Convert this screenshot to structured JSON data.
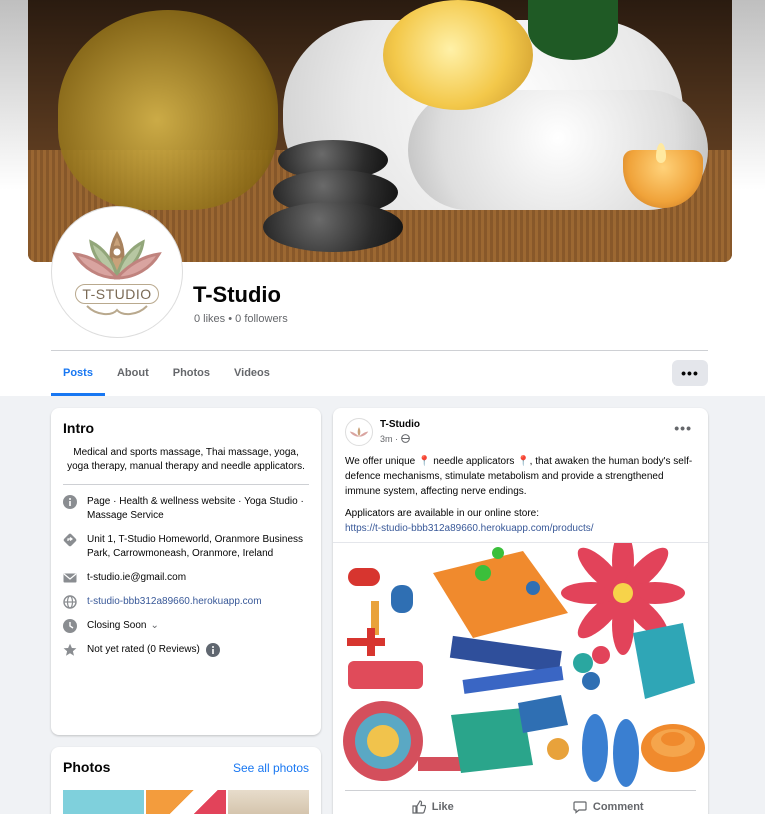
{
  "page": {
    "name": "T-Studio",
    "stats": "0 likes • 0 followers",
    "logo_text": "T-STUDIO"
  },
  "tabs": [
    {
      "label": "Posts",
      "active": true
    },
    {
      "label": "About",
      "active": false
    },
    {
      "label": "Photos",
      "active": false
    },
    {
      "label": "Videos",
      "active": false
    }
  ],
  "more_button_label": "•••",
  "intro": {
    "title": "Intro",
    "bio": "Medical and sports massage, Thai massage, yoga, yoga therapy, manual therapy and needle applicators.",
    "category": "Page · Health & wellness website · Yoga Studio · Massage Service",
    "address": "Unit 1, T-Studio Homeworld, Oranmore Business Park, Carrowmoneash, Oranmore, Ireland",
    "email": "t-studio.ie@gmail.com",
    "website": "t-studio-bbb312a89660.herokuapp.com",
    "hours": "Closing Soon",
    "rating": "Not yet rated (0 Reviews)"
  },
  "photos": {
    "title": "Photos",
    "see_all": "See all photos"
  },
  "post": {
    "author": "T-Studio",
    "time": "3m ·",
    "more_label": "•••",
    "text_1": "We offer unique 📍 needle applicators 📍, that awaken the human body's self-defence mechanisms, stimulate metabolism and provide a strengthened immune system, affecting nerve endings.",
    "text_2": "Applicators are available  in our online store:",
    "link": "https://t-studio-bbb312a89660.herokuapp.com/products/",
    "like_label": "Like",
    "comment_label": "Comment"
  },
  "colors": {
    "accent": "#1877f2",
    "link": "#385898",
    "background": "#f0f2f5"
  }
}
